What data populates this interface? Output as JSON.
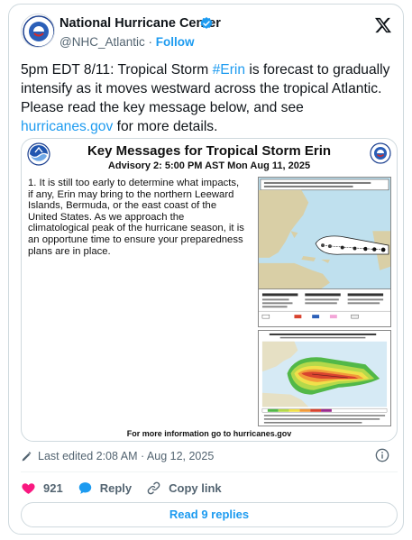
{
  "account": {
    "name": "National Hurricane Center",
    "handle": "@NHC_Atlantic",
    "separator": "·",
    "follow_label": "Follow",
    "avatar_text": "NATIONAL WEATHER SERVICE"
  },
  "tweet": {
    "text_1": "5pm EDT 8/11: Tropical Storm ",
    "hashtag": "#Erin",
    "text_2": " is forecast to gradually intensify as it moves westward across the tropical Atlantic. Please read the key message below, and see ",
    "link": "hurricanes.gov",
    "text_3": " for more details."
  },
  "media": {
    "title": "Key Messages for Tropical Storm Erin",
    "subtitle": "Advisory 2: 5:00 PM AST Mon Aug 11, 2025",
    "message": "1. It is still too early to determine what impacts, if any, Erin may bring to the northern Leeward Islands, Bermuda, or the east coast of the United States. As we approach the climatological peak of the hurricane season, it is an opportune time to ensure your preparedness plans are in place.",
    "footer": "For more information go to hurricanes.gov",
    "map2_title": "Tropical Storm Force Wind Speed Probabilities (Preliminary)"
  },
  "meta": {
    "edited": "Last edited 2:08 AM · Aug 12, 2025"
  },
  "actions": {
    "likes": "921",
    "reply_label": "Reply",
    "copy_label": "Copy link"
  },
  "read_replies": "Read 9 replies",
  "colors": {
    "accent": "#1d9bf0",
    "like": "#f91880",
    "muted": "#536471"
  }
}
